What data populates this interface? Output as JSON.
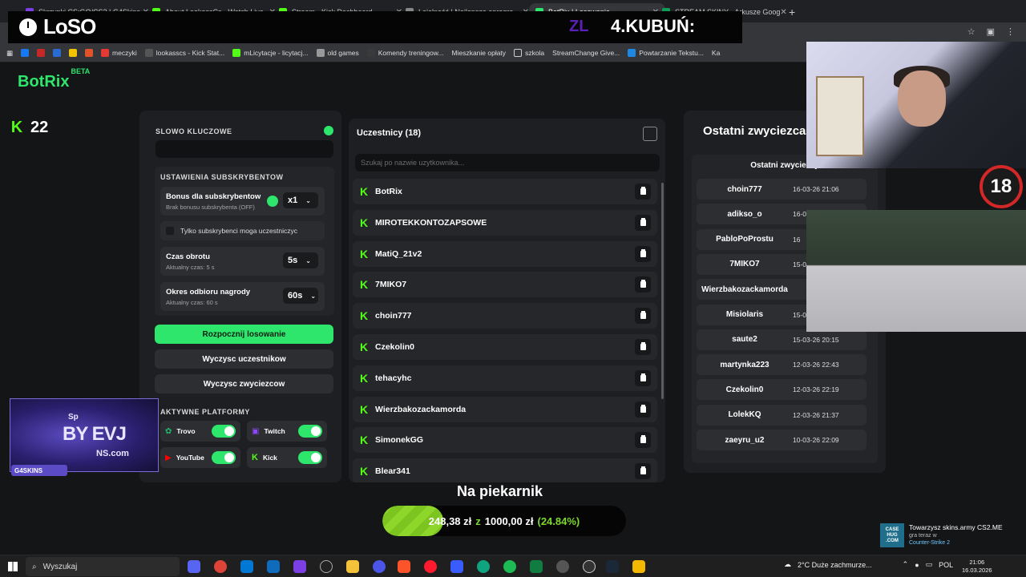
{
  "browser": {
    "tabs": [
      {
        "title": "Skrzynki CS:GO/CS2 | G4Skins",
        "color": "#7b3fe4"
      },
      {
        "title": "About LookassCs - Watch Live",
        "color": "#53fc18"
      },
      {
        "title": "Stream - Kick Dashboard",
        "color": "#53fc18"
      },
      {
        "title": "Lojalność | Najlepsze oprogra",
        "color": "#888888"
      },
      {
        "title": "BotRix | Losowania",
        "color": "#2ee66b"
      },
      {
        "title": "STREAM SKINY - Arkusze Goog",
        "color": "#0f9d58"
      }
    ],
    "bookmarks": [
      "meczyki",
      "lookasscs - Kick Stat...",
      "mLicytacje - licytacj...",
      "old games",
      "Komendy treningow...",
      "Mieszkanie opłaty",
      "szkola",
      "StreamChange Give...",
      "Powtarzanie Tekstu...",
      "Ka"
    ]
  },
  "overlay": {
    "brand": "LoSO",
    "zl": "ZL",
    "rank": "4.KUBUŃ:"
  },
  "app": {
    "logo": "BotRix",
    "beta": "BETA",
    "count": "22"
  },
  "left": {
    "keyword_label": "SLOWO KLUCZOWE",
    "sub_settings_label": "USTAWIENIA SUBSKRYBENTOW",
    "bonus_title": "Bonus dla subskrybentow",
    "bonus_sub": "Brak bonusu subskrybenta (OFF)",
    "bonus_value": "x1",
    "only_subs": "Tylko subskrybenci moga uczestniczyc",
    "spin_title": "Czas obrotu",
    "spin_sub": "Aktualny czas: 5 s",
    "spin_value": "5s",
    "claim_title": "Okres odbioru nagrody",
    "claim_sub": "Aktualny czas: 60 s",
    "claim_value": "60s",
    "start_btn": "Rozpocznij losowanie",
    "clear_participants": "Wyczysc uczestnikow",
    "clear_winners": "Wyczysc zwyciezcow",
    "platforms_label": "AKTYWNE PLATFORMY",
    "platforms": [
      "Trovo",
      "Twitch",
      "YouTube",
      "Kick"
    ]
  },
  "participants": {
    "title": "Uczestnicy (18)",
    "search_placeholder": "Szukaj po nazwie uzytkownika...",
    "list": [
      "BotRix",
      "MIROTEKKONTOZAPSOWE",
      "MatiQ_21v2",
      "7MIKO7",
      "choin777",
      "Czekolin0",
      "tehacyhc",
      "Wierzbakozackamorda",
      "SimonekGG",
      "Blear341"
    ]
  },
  "winners": {
    "title": "Ostatni zwyciezca",
    "subtitle": "Ostatni zwyciezcy",
    "list": [
      {
        "name": "choin777",
        "date": "16-03-26 21:06"
      },
      {
        "name": "adikso_o",
        "date": "16-03-"
      },
      {
        "name": "PabloPoProstu",
        "date": "16"
      },
      {
        "name": "7MIKO7",
        "date": "15-03-"
      },
      {
        "name": "Wierzbakozackamorda",
        "date": ""
      },
      {
        "name": "Misiolaris",
        "date": "15-03"
      },
      {
        "name": "saute2",
        "date": "15-03-26 20:15"
      },
      {
        "name": "martynka223",
        "date": "12-03-26 22:43"
      },
      {
        "name": "Czekolin0",
        "date": "12-03-26 22:19"
      },
      {
        "name": "LolekKQ",
        "date": "12-03-26 21:37"
      },
      {
        "name": "zaeyru_u2",
        "date": "10-03-26 22:09"
      }
    ]
  },
  "stream": {
    "age_badge": "18",
    "sponsor_sp": "Sp",
    "sponsor_main": "BY EVJ",
    "sponsor_url": "NS.com",
    "sponsor_brand": "G4SKINS",
    "goal_title": "Na piekarnik",
    "goal_current": "248,38 zł",
    "goal_of": "z",
    "goal_target": "1000,00 zł",
    "goal_pct_text": "(24.84%)",
    "goal_fraction": 0.2484
  },
  "notification": {
    "box": "CASE HUG .COM",
    "line1": "Towarzysz skins.army CS2.ME",
    "line2": "gra teraz w",
    "line3": "Counter-Strike 2"
  },
  "taskbar": {
    "search": "Wyszukaj",
    "weather": "2°C  Duże zachmurze...",
    "lang": "POL",
    "time": "21:06",
    "date": "16.03.2026"
  }
}
